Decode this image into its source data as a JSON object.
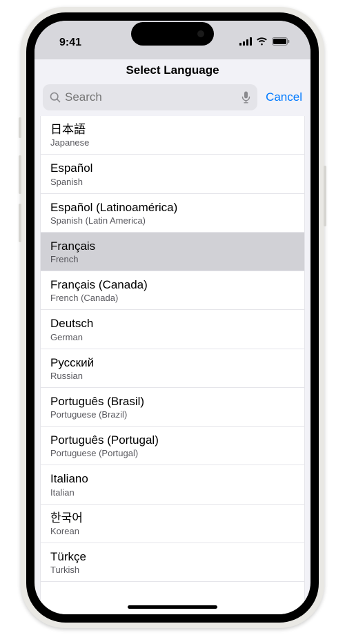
{
  "status": {
    "time": "9:41"
  },
  "header": {
    "title": "Select Language"
  },
  "search": {
    "placeholder": "Search",
    "cancel_label": "Cancel"
  },
  "languages": [
    {
      "native": "日本語",
      "english": "Japanese",
      "selected": false
    },
    {
      "native": "Español",
      "english": "Spanish",
      "selected": false
    },
    {
      "native": "Español (Latinoamérica)",
      "english": "Spanish (Latin America)",
      "selected": false
    },
    {
      "native": "Français",
      "english": "French",
      "selected": true
    },
    {
      "native": "Français (Canada)",
      "english": "French (Canada)",
      "selected": false
    },
    {
      "native": "Deutsch",
      "english": "German",
      "selected": false
    },
    {
      "native": "Русский",
      "english": "Russian",
      "selected": false
    },
    {
      "native": "Português (Brasil)",
      "english": "Portuguese (Brazil)",
      "selected": false
    },
    {
      "native": "Português (Portugal)",
      "english": "Portuguese (Portugal)",
      "selected": false
    },
    {
      "native": "Italiano",
      "english": "Italian",
      "selected": false
    },
    {
      "native": "한국어",
      "english": "Korean",
      "selected": false
    },
    {
      "native": "Türkçe",
      "english": "Turkish",
      "selected": false
    }
  ]
}
